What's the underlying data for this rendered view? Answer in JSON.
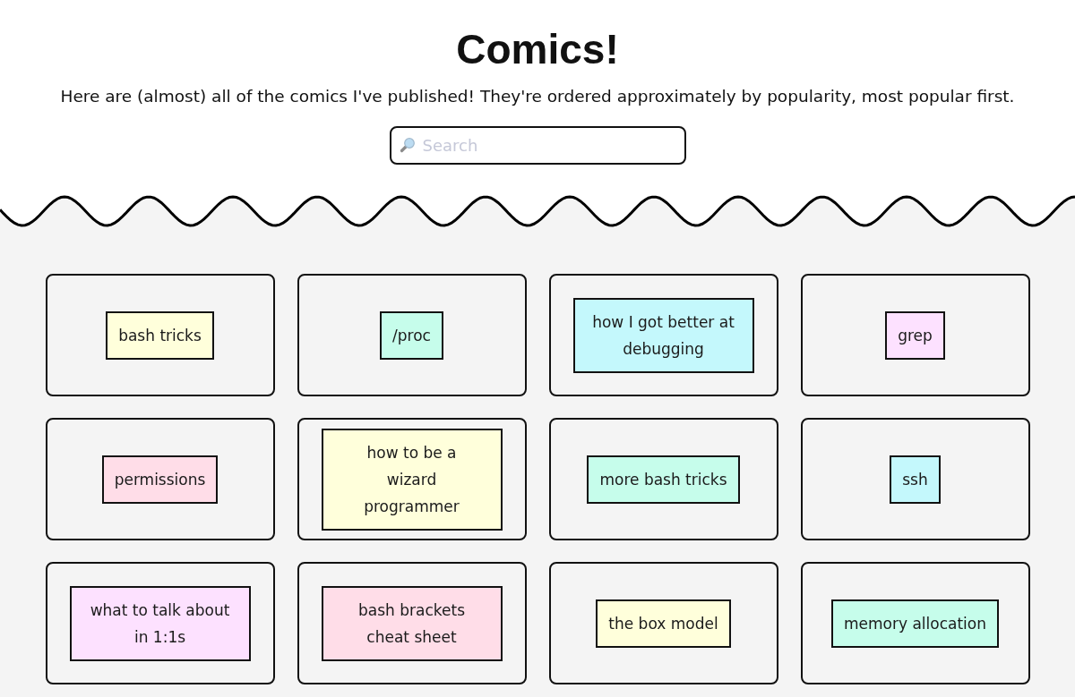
{
  "header": {
    "title": "Comics!",
    "subtitle": "Here are (almost) all of the comics I've published! They're ordered approximately by popularity, most popular first."
  },
  "search": {
    "placeholder": "Search"
  },
  "comics": [
    {
      "lines": [
        "bash tricks"
      ],
      "color": "#ffffdb"
    },
    {
      "lines": [
        "/proc"
      ],
      "color": "#c6fdeb"
    },
    {
      "lines": [
        "how I got better at",
        "debugging"
      ],
      "color": "#c4f8fc"
    },
    {
      "lines": [
        "grep"
      ],
      "color": "#fde1ff"
    },
    {
      "lines": [
        "permissions"
      ],
      "color": "#ffdde8"
    },
    {
      "lines": [
        "how to be a",
        "wizard",
        "programmer"
      ],
      "color": "#ffffdb"
    },
    {
      "lines": [
        "more bash tricks"
      ],
      "color": "#c6fdeb"
    },
    {
      "lines": [
        "ssh"
      ],
      "color": "#c4f8fc"
    },
    {
      "lines": [
        "what to talk about",
        "in 1:1s"
      ],
      "color": "#fde1ff"
    },
    {
      "lines": [
        "bash brackets",
        "cheat sheet"
      ],
      "color": "#ffdde8"
    },
    {
      "lines": [
        "the box model"
      ],
      "color": "#ffffdb"
    },
    {
      "lines": [
        "memory allocation"
      ],
      "color": "#c6fdeb"
    }
  ]
}
